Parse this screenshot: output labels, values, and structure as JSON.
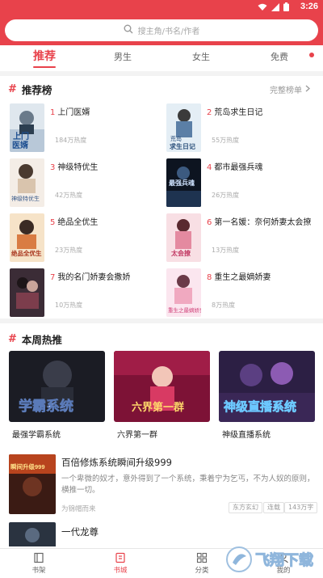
{
  "status_bar": {
    "time": "3:26",
    "icons": [
      "wifi-icon",
      "signal-icon",
      "battery-icon"
    ]
  },
  "search": {
    "placeholder": "搜主角/书名/作者"
  },
  "tabs": [
    {
      "label": "推荐",
      "active": true
    },
    {
      "label": "男生",
      "active": false
    },
    {
      "label": "女生",
      "active": false
    },
    {
      "label": "免费",
      "active": false
    }
  ],
  "ranking": {
    "title": "推荐榜",
    "more": "完整榜单",
    "items": [
      {
        "rank": "1",
        "title": "上门医婿",
        "heat": "184万热度",
        "cover_text": "上门医婿"
      },
      {
        "rank": "2",
        "title": "荒岛求生日记",
        "heat": "55万热度",
        "cover_text": "荒岛求生日记"
      },
      {
        "rank": "3",
        "title": "神级特优生",
        "heat": "42万热度",
        "cover_text": "神级特优生"
      },
      {
        "rank": "4",
        "title": "都市最强兵魂",
        "heat": "26万热度",
        "cover_text": "最强兵魂"
      },
      {
        "rank": "5",
        "title": "绝品全优生",
        "heat": "23万热度",
        "cover_text": "绝品全优生"
      },
      {
        "rank": "6",
        "title": "第一名媛：奈何娇妻太会撩",
        "heat": "13万热度",
        "cover_text": "太会撩"
      },
      {
        "rank": "7",
        "title": "我的名门娇妻会撒娇",
        "heat": "10万热度",
        "cover_text": ""
      },
      {
        "rank": "8",
        "title": "重生之最嫡娇妻",
        "heat": "8万热度",
        "cover_text": "重生之最嫡娇妻"
      }
    ]
  },
  "weekly": {
    "title": "本周热推",
    "books": [
      {
        "title": "最强学霸系统",
        "cover_text": "学霸系统"
      },
      {
        "title": "六界第一群",
        "cover_text": "六界第一群"
      },
      {
        "title": "神级直播系统",
        "cover_text": "神级直播系统"
      }
    ],
    "featured": {
      "title": "百倍修炼系统瞬间升级999",
      "desc": "一个卑微的奴才，意外得到了一个系统，秉着宁为乞丐，不为人奴的原则，横推一切。",
      "author": "为锦帽而来",
      "tags": [
        "东方玄幻",
        "连载",
        "143万字"
      ],
      "cover_text": "瞬间升级999"
    },
    "second": {
      "title": "一代龙尊"
    }
  },
  "bottom_nav": [
    {
      "label": "书架",
      "active": false
    },
    {
      "label": "书城",
      "active": true
    },
    {
      "label": "分类",
      "active": false
    },
    {
      "label": "我的",
      "active": false
    }
  ],
  "watermark": {
    "text": "飞翔下载"
  },
  "colors": {
    "accent": "#e8424b"
  }
}
